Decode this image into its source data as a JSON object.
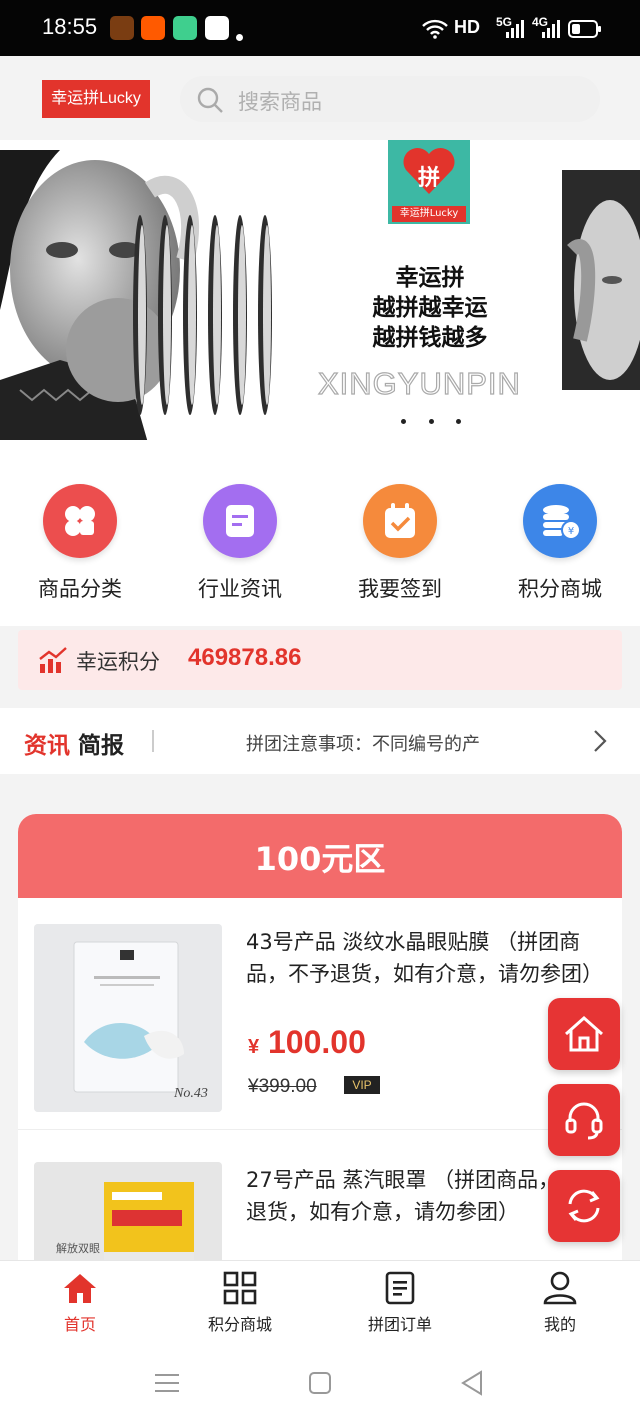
{
  "status_bar": {
    "time": "18:55",
    "network": "HD",
    "signal_1": "5G",
    "signal_2": "4G"
  },
  "header": {
    "logo_text": "幸运拼Lucky",
    "search_placeholder": "搜索商品"
  },
  "banner": {
    "badge_char": "拼",
    "badge_caption": "幸运拼Lucky",
    "line1": "幸运拼",
    "line2": "越拼越幸运",
    "line3": "越拼钱越多",
    "watermark": "XINGYUNPIN"
  },
  "features": [
    {
      "label": "商品分类",
      "icon": "clover-icon",
      "color": "#ec4e4e"
    },
    {
      "label": "行业资讯",
      "icon": "document-icon",
      "color": "#a36ef0"
    },
    {
      "label": "我要签到",
      "icon": "calendar-check-icon",
      "color": "#f58a3c"
    },
    {
      "label": "积分商城",
      "icon": "coins-icon",
      "color": "#3d86e8"
    }
  ],
  "points": {
    "label": "幸运积分",
    "value": "469878.86"
  },
  "news": {
    "title_red": "资讯",
    "title_black": "简报",
    "ticker": "拼团注意事项：不同编号的产"
  },
  "section": {
    "title": "100元区"
  },
  "products": [
    {
      "title": "43号产品 淡纹水晶眼贴膜 （拼团商品，不予退货，如有介意，请勿参团）",
      "currency": "¥",
      "price": "100.00",
      "old_price": "¥399.00",
      "vip": "VIP",
      "img_label": "No.43"
    },
    {
      "title": "27号产品 蒸汽眼罩 （拼团商品，不予退货，如有介意，请勿参团）",
      "img_label": "解放双眼"
    }
  ],
  "floating": [
    "home-icon",
    "headset-icon",
    "refresh-icon"
  ],
  "bottom_nav": [
    {
      "label": "首页",
      "icon": "home-icon",
      "active": true
    },
    {
      "label": "积分商城",
      "icon": "grid-icon",
      "active": false
    },
    {
      "label": "拼团订单",
      "icon": "order-icon",
      "active": false
    },
    {
      "label": "我的",
      "icon": "user-icon",
      "active": false
    }
  ],
  "colors": {
    "brand": "#e2342c",
    "section_header": "#f36b6b",
    "float_button": "#e63434"
  }
}
